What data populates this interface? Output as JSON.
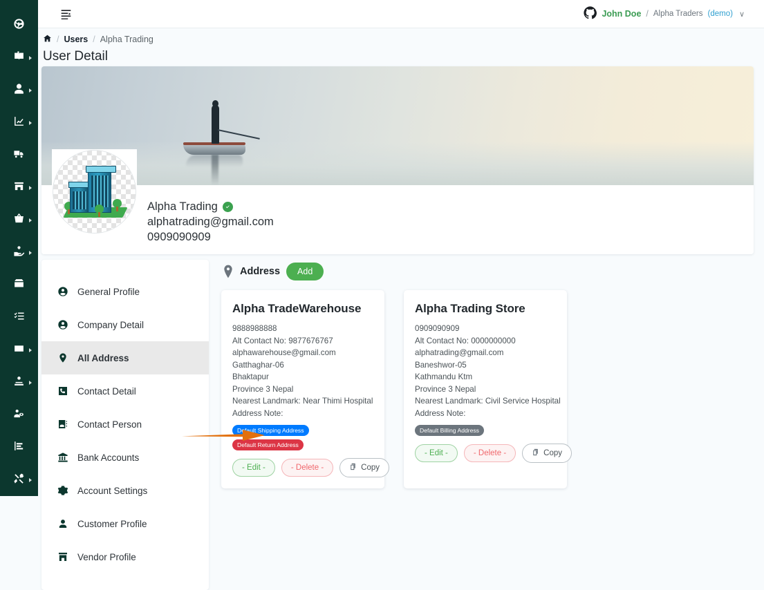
{
  "colors": {
    "rail_bg": "#0c372e",
    "page_bg": "#f8fbfd",
    "accent_green": "#4caf50",
    "badge_blue": "#007bff",
    "badge_red": "#dc3545",
    "badge_gray": "#6c757d",
    "arrow_orange": "#e2700d",
    "username_green": "#3a9b52",
    "demo_blue": "#2f9fd0"
  },
  "icon_rail": {
    "items": [
      {
        "name": "dashboard-icon",
        "has_caret": false
      },
      {
        "name": "catalog-book-icon",
        "has_caret": true
      },
      {
        "name": "user-icon",
        "has_caret": true
      },
      {
        "name": "analytics-chart-icon",
        "has_caret": true
      },
      {
        "name": "delivery-truck-icon",
        "has_caret": false
      },
      {
        "name": "store-icon",
        "has_caret": true
      },
      {
        "name": "basket-icon",
        "has_caret": true
      },
      {
        "name": "hand-money-icon",
        "has_caret": true
      },
      {
        "name": "open-box-icon",
        "has_caret": false
      },
      {
        "name": "checklist-icon",
        "has_caret": false
      },
      {
        "name": "wallet-icon",
        "has_caret": true
      },
      {
        "name": "user-group-icon",
        "has_caret": true
      },
      {
        "name": "people-settings-icon",
        "has_caret": false
      },
      {
        "name": "report-bar-icon",
        "has_caret": false
      },
      {
        "name": "tools-icon",
        "has_caret": true
      }
    ]
  },
  "topbar": {
    "menu_fold_icon": "menu-fold-icon",
    "user": {
      "avatar_icon": "github-avatar-icon",
      "name": "John Doe",
      "separator": "/",
      "org": "Alpha Traders",
      "demo_tag": "(demo)",
      "caret": "∨"
    }
  },
  "breadcrumb": {
    "home_icon": "home-icon",
    "sep": "/",
    "items": [
      {
        "label": "Users",
        "strong": true
      },
      {
        "label": "Alpha Trading",
        "strong": false
      }
    ]
  },
  "page": {
    "title": "User Detail"
  },
  "hero": {
    "banner_alt": "misty-lake-fisherman-banner",
    "avatar_alt": "office-building-avatar",
    "name": "Alpha Trading",
    "verified_icon": "verified-check-icon",
    "email": "alphatrading@gmail.com",
    "phone": "0909090909"
  },
  "nav": {
    "items": [
      {
        "label": "General Profile",
        "icon": "account-circle-icon",
        "active": false
      },
      {
        "label": "Company Detail",
        "icon": "account-circle-icon",
        "active": false
      },
      {
        "label": "All Address",
        "icon": "map-pin-icon",
        "active": true
      },
      {
        "label": "Contact Detail",
        "icon": "phone-square-icon",
        "active": false
      },
      {
        "label": "Contact Person",
        "icon": "contact-card-icon",
        "active": false
      },
      {
        "label": "Bank Accounts",
        "icon": "bank-icon",
        "active": false
      },
      {
        "label": "Account Settings",
        "icon": "gear-icon",
        "active": false
      },
      {
        "label": "Customer Profile",
        "icon": "person-icon",
        "active": false
      },
      {
        "label": "Vendor Profile",
        "icon": "storefront-icon",
        "active": false
      }
    ]
  },
  "address": {
    "pin_icon": "map-pin-icon",
    "title": "Address",
    "add_label": "Add",
    "cards": [
      {
        "title": "Alpha TradeWarehouse",
        "lines": [
          "9888988888",
          "Alt Contact No: 9877676767",
          "alphawarehouse@gmail.com",
          "Gatthaghar-06",
          "Bhaktapur",
          "Province 3 Nepal",
          "Nearest Landmark: Near Thimi Hospital",
          "Address Note:"
        ],
        "badges": [
          {
            "label": "Default Shipping Address",
            "tone": "blue"
          },
          {
            "label": "Default Return Address",
            "tone": "red"
          }
        ],
        "actions": {
          "edit": "- Edit -",
          "delete": "- Delete -",
          "copy": "Copy",
          "copy_icon": "copy-icon"
        }
      },
      {
        "title": "Alpha Trading Store",
        "lines": [
          "0909090909",
          "Alt Contact No: 0000000000",
          "alphatrading@gmail.com",
          "Baneshwor-05",
          "Kathmandu Ktm",
          "Province 3 Nepal",
          "Nearest Landmark: Civil Service Hospital",
          "Address Note:"
        ],
        "badges": [
          {
            "label": "Default Billing Address",
            "tone": "gray"
          }
        ],
        "actions": {
          "edit": "- Edit -",
          "delete": "- Delete -",
          "copy": "Copy",
          "copy_icon": "copy-icon"
        }
      }
    ]
  },
  "annotation": {
    "arrow_icon": "orange-arrow-pointing-right",
    "points_to": "- Edit -"
  }
}
